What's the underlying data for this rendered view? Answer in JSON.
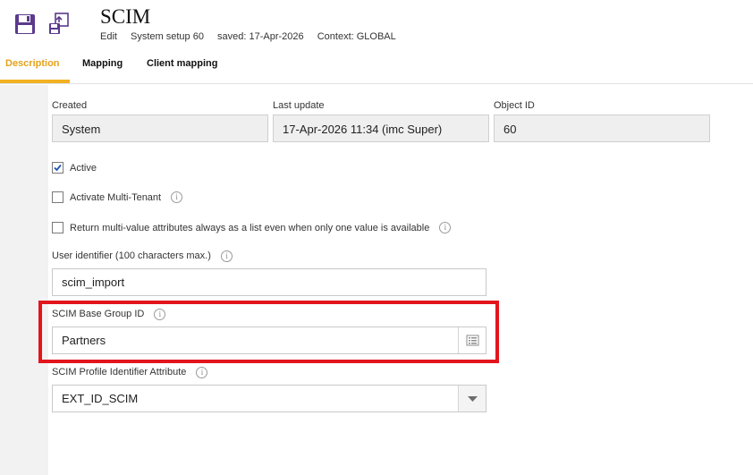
{
  "header": {
    "title": "SCIM",
    "meta": {
      "mode": "Edit",
      "system_setup": "System setup 60",
      "saved": "saved: 17-Apr-2026",
      "context": "Context: GLOBAL"
    }
  },
  "tabs": [
    {
      "label": "Description",
      "active": true
    },
    {
      "label": "Mapping",
      "active": false
    },
    {
      "label": "Client mapping",
      "active": false
    }
  ],
  "info_fields": {
    "created": {
      "label": "Created",
      "value": "System"
    },
    "last_update": {
      "label": "Last update",
      "value": "17-Apr-2026 11:34 (imc Super)"
    },
    "object_id": {
      "label": "Object ID",
      "value": "60"
    }
  },
  "checkboxes": {
    "active": {
      "label": "Active",
      "checked": true
    },
    "multi_tenant": {
      "label": "Activate Multi-Tenant",
      "checked": false
    },
    "multi_value": {
      "label": "Return multi-value attributes always as a list even when only one value is available",
      "checked": false
    }
  },
  "fields": {
    "user_identifier": {
      "label": "User identifier (100 characters max.)",
      "value": "scim_import"
    },
    "base_group": {
      "label": "SCIM Base Group ID",
      "value": "Partners"
    },
    "profile_attr": {
      "label": "SCIM Profile Identifier Attribute",
      "value": "EXT_ID_SCIM"
    }
  },
  "colors": {
    "accent": "#f2b122",
    "highlight": "#e3151c",
    "icon": "#5b3a8c"
  },
  "icons": {
    "info": "i"
  }
}
